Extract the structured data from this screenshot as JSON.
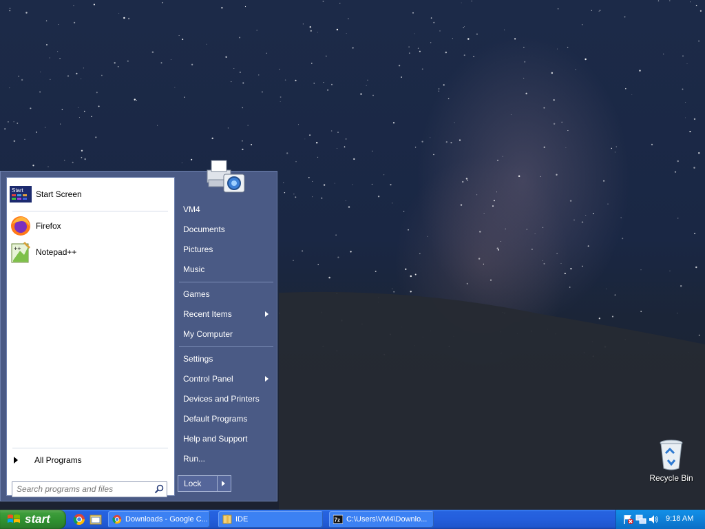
{
  "start_menu": {
    "pinned": [
      {
        "label": "Start Screen",
        "icon": "start-screen-icon"
      },
      {
        "label": "Firefox",
        "icon": "firefox-icon"
      },
      {
        "label": "Notepad++",
        "icon": "notepad-plus-plus-icon"
      }
    ],
    "all_programs": "All Programs",
    "search_placeholder": "Search programs and files",
    "right_items": [
      {
        "label": "VM4",
        "submenu": false
      },
      {
        "label": "Documents",
        "submenu": false
      },
      {
        "label": "Pictures",
        "submenu": false
      },
      {
        "label": "Music",
        "submenu": false
      },
      {
        "label": "Games",
        "submenu": false
      },
      {
        "label": "Recent Items",
        "submenu": true
      },
      {
        "label": "My Computer",
        "submenu": false
      },
      {
        "label": "Settings",
        "submenu": false
      },
      {
        "label": "Control Panel",
        "submenu": true
      },
      {
        "label": "Devices and Printers",
        "submenu": false
      },
      {
        "label": "Default Programs",
        "submenu": false
      },
      {
        "label": "Help and Support",
        "submenu": false
      },
      {
        "label": "Run...",
        "submenu": false
      }
    ],
    "lock_label": "Lock"
  },
  "desktop": {
    "recycle_bin": "Recycle Bin"
  },
  "taskbar": {
    "start_label": "start",
    "tasks": [
      {
        "label": "Downloads - Google C...",
        "icon": "chrome-icon"
      },
      {
        "label": "IDE",
        "icon": "folder-icon"
      },
      {
        "label": "C:\\Users\\VM4\\Downlo...",
        "icon": "7zip-icon"
      }
    ],
    "clock": "9:18 AM"
  },
  "colors": {
    "menu_blue": "#4a5a85",
    "taskbar_blue": "#245edc",
    "start_green": "#3c9c3a",
    "tray_blue": "#0f80d8"
  }
}
